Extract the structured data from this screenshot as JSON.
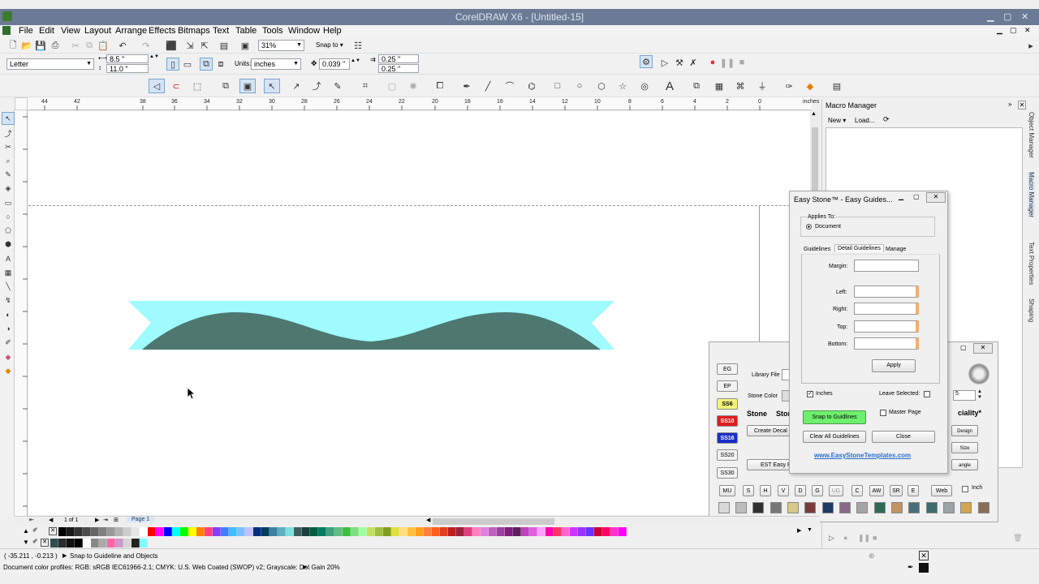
{
  "window": {
    "title": "CorelDRAW X6 - [Untitled-15]"
  },
  "menu": [
    "File",
    "Edit",
    "View",
    "Layout",
    "Arrange",
    "Effects",
    "Bitmaps",
    "Text",
    "Table",
    "Tools",
    "Window",
    "Help"
  ],
  "toolbar": {
    "zoom": "31%",
    "snap_to": "Snap to"
  },
  "property_bar": {
    "page_size": "Letter",
    "width": "8.5 \"",
    "height": "11.0 \"",
    "units_label": "Units:",
    "units": "inches",
    "nudge": "0.039 \"",
    "dup_x": "0.25 \"",
    "dup_y": "0.25 \""
  },
  "ruler": {
    "h_ticks": [
      "44",
      "42",
      "38",
      "36",
      "34",
      "32",
      "30",
      "28",
      "26",
      "24",
      "22",
      "20",
      "18",
      "16",
      "14",
      "12",
      "10",
      "8",
      "6",
      "4",
      "2",
      "0"
    ],
    "units": "inches"
  },
  "macro_manager": {
    "title": "Macro Manager",
    "new": "New",
    "load": "Load..."
  },
  "side_tabs": [
    "Object Manager",
    "Macro Manager",
    "Text Properties",
    "Shaping"
  ],
  "easy_guides": {
    "title": "Easy Stone™ - Easy Guides...",
    "applies_to": "Applies To:",
    "document": "Document",
    "tabs": [
      "Guidelines",
      "Detail Guidelines",
      "Manage"
    ],
    "margin": "Margin:",
    "left": "Left:",
    "right": "Right:",
    "top": "Top:",
    "bottom": "Bottom:",
    "apply": "Apply",
    "inches": "Inches",
    "leave_selected": "Leave Selected:",
    "snap_to_guidelines": "Snap to Guidlines",
    "master_page": "Master Page",
    "clear_all": "Clear All Guidelines",
    "close": "Close",
    "link": "www.EasyStoneTemplates.com"
  },
  "stone_panel": {
    "library_file": "Library File",
    "stone_color": "Stone Color",
    "stone": "Stone",
    "sto": "Stor",
    "create_decal": "Create Decal C",
    "est_easy": "EST Easy P",
    "ciality": "ciality*",
    "design": "Design",
    "size": "Size",
    "angle": "angle",
    "spin_value": "5",
    "side_buttons": [
      {
        "label": "EG",
        "color": "#f2f2f2",
        "text": "#000"
      },
      {
        "label": "EP",
        "color": "#f2f2f2",
        "text": "#000"
      },
      {
        "label": "SS6",
        "color": "#f3f27a",
        "text": "#000"
      },
      {
        "label": "SS10",
        "color": "#e01b1b",
        "text": "#fff"
      },
      {
        "label": "SS16",
        "color": "#1a2ec9",
        "text": "#fff"
      },
      {
        "label": "SS20",
        "color": "#f2f2f2",
        "text": "#000"
      },
      {
        "label": "SS30",
        "color": "#f2f2f2",
        "text": "#000"
      }
    ],
    "row_buttons": [
      "MU",
      "S",
      "H",
      "V",
      "D",
      "G",
      "UG",
      "C",
      "AW",
      "SR",
      "E",
      "Web"
    ],
    "inch": "Inch",
    "swatches": [
      "#d9d9d9",
      "#bdbdbd",
      "#2f2f2f",
      "#777777",
      "#d8c98a",
      "#7b3a3a",
      "#1f3a66",
      "#8a6a8a",
      "#a4a4a4",
      "#2e6a55",
      "#c49362",
      "#4b6e7a",
      "#3e6b6b",
      "#9aa3a6",
      "#d3a54f",
      "#8a6d57"
    ]
  },
  "doc_nav": {
    "page_count": "1 of 1",
    "page_tab": "Page 1"
  },
  "status": {
    "coords": "( -35.211 , -0.213 )",
    "snap_msg": "Snap to Guideline and Objects",
    "profiles": "Document color profiles: RGB: sRGB IEC61966-2.1; CMYK: U.S. Web Coated (SWOP) v2; Grayscale: Dot Gain 20%"
  },
  "palette_row1": [
    "#000000",
    "#1a1a1a",
    "#333333",
    "#4d4d4d",
    "#666666",
    "#808080",
    "#999999",
    "#b3b3b3",
    "#cccccc",
    "#e6e6e6",
    "#ffffff",
    "#ff0000",
    "#ff00ff",
    "#0000ff",
    "#00ffff",
    "#00ff00",
    "#ffff00",
    "#ff7f00",
    "#ff3f7f",
    "#7f3fff",
    "#3f7fff",
    "#3fbfff",
    "#7fbfff",
    "#bfbfff",
    "#002f7f",
    "#003f5f",
    "#3f7f9f",
    "#5fafbf",
    "#7fdfdf",
    "#3f5f5f",
    "#1f3f3f",
    "#005f3f",
    "#007f5f",
    "#3f9f7f",
    "#5fbf7f",
    "#3fbf3f",
    "#7fdf7f",
    "#9fff9f",
    "#bfdf5f",
    "#9fbf3f",
    "#7f9f1f",
    "#dfdf3f",
    "#ffdf7f",
    "#ffbf3f",
    "#ff9f1f",
    "#ff7f3f",
    "#ff5f1f",
    "#df3f1f",
    "#bf1f1f",
    "#9f1f3f",
    "#df3f7f",
    "#ff7fbf",
    "#df7fdf",
    "#bf5fbf",
    "#9f3f9f",
    "#7f1f7f",
    "#5f1f5f",
    "#bf3fbf",
    "#df5fdf",
    "#ff9fff",
    "#ff00aa",
    "#ff3366",
    "#ff66cc",
    "#cc33ff",
    "#9933ff",
    "#6633ff",
    "#cc0033",
    "#ff0066",
    "#ff33cc",
    "#ff00ff"
  ],
  "palette_row2": [
    "#2f4f4f",
    "#2b2b2b",
    "#111111",
    "#000000",
    "#ffffff",
    "#888888",
    "#aaaaaa",
    "#ff66aa",
    "#cc99cc",
    "#d4d4d4",
    "#222222",
    "#7fffff"
  ]
}
